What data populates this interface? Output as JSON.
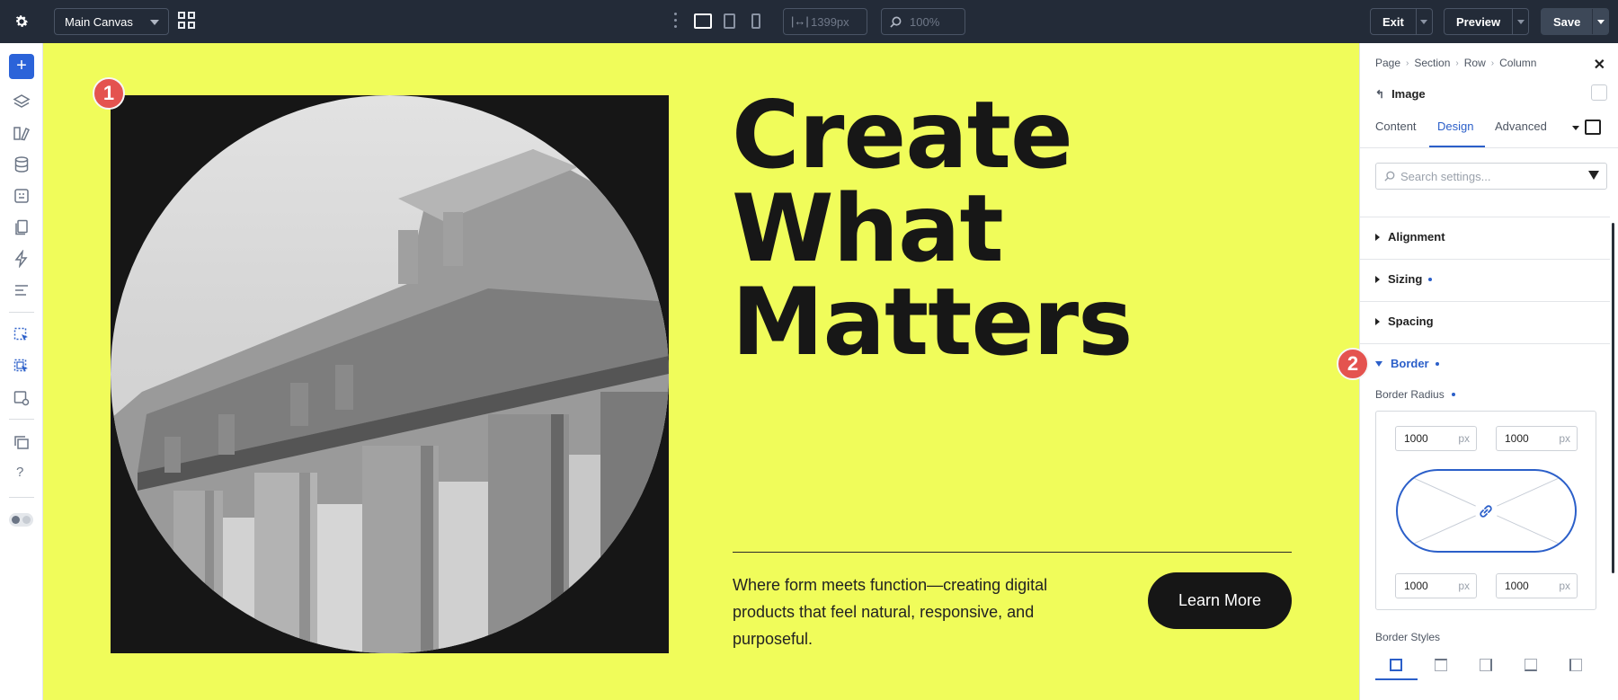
{
  "topbar": {
    "canvas_select": "Main Canvas",
    "width_value": "1399px",
    "zoom_value": "100%",
    "exit_label": "Exit",
    "preview_label": "Preview",
    "save_label": "Save"
  },
  "canvas": {
    "headline_lines": [
      "Create",
      "What",
      "Matters"
    ],
    "tagline": "Where form meets function—creating digital products that feel natural, responsive, and purposeful.",
    "button_label": "Learn More",
    "marker_1": "1",
    "marker_2": "2",
    "background_color": "#f0fc5a"
  },
  "panel": {
    "breadcrumbs": [
      "Page",
      "Section",
      "Row",
      "Column"
    ],
    "element_title": "Image",
    "tabs": [
      "Content",
      "Design",
      "Advanced"
    ],
    "active_tab": "Design",
    "search_placeholder": "Search settings...",
    "sections": {
      "alignment": "Alignment",
      "sizing": "Sizing",
      "spacing": "Spacing",
      "border": "Border"
    },
    "border_radius_label": "Border Radius",
    "radius": {
      "top_left": "1000",
      "top_right": "1000",
      "bottom_left": "1000",
      "bottom_right": "1000",
      "unit": "px"
    },
    "border_styles_label": "Border Styles",
    "accent_color": "#2b5fc9"
  }
}
